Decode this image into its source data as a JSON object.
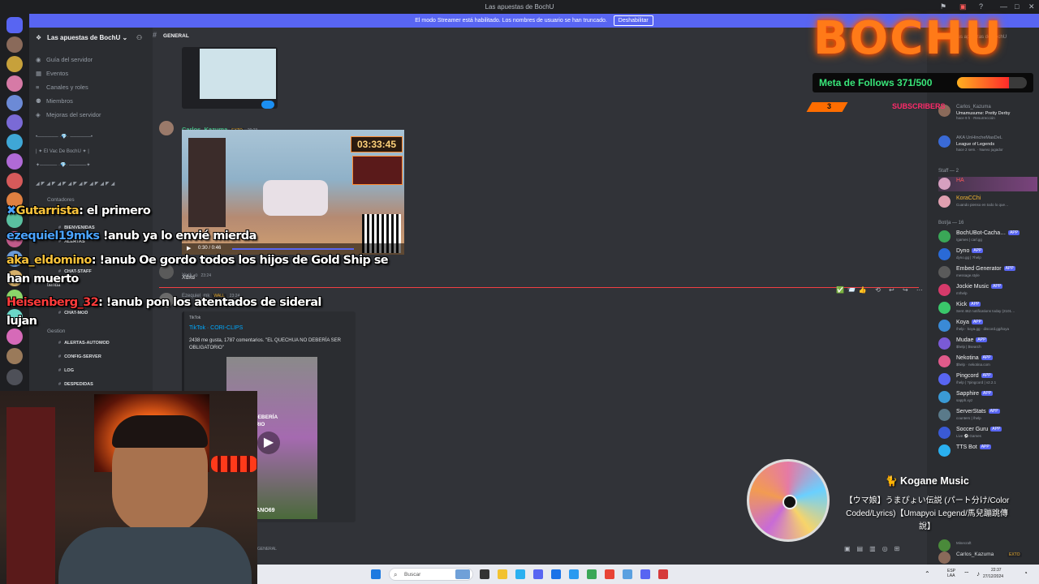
{
  "window": {
    "title": "Las apuestas de BochU",
    "controls": [
      "—",
      "□",
      "✕"
    ]
  },
  "banner": {
    "text": "El modo Streamer está habilitado. Los nombres de usuario se han truncado.",
    "button": "Deshabilitar"
  },
  "sidebar": {
    "server_name": "Las apuestas de BochU",
    "nav": [
      {
        "label": "Guía del servidor",
        "icon": "compass-icon"
      },
      {
        "label": "Eventos",
        "icon": "calendar-icon"
      },
      {
        "label": "Canales y roles",
        "icon": "list-icon"
      },
      {
        "label": "Miembros",
        "icon": "members-icon"
      },
      {
        "label": "Mejoras del servidor",
        "icon": "boost-icon"
      }
    ],
    "decor": [
      "•────── ·💎· ──────•",
      "| ✦ El Vac De BochU ✦ |",
      "✦───── ·💎· ─────✦"
    ],
    "categories": [
      {
        "label": "Contadores"
      },
      {
        "label": "Gestion"
      }
    ],
    "channels": [
      "BIENVENIDAS",
      "ALERTAS",
      "CHAT-STAFF",
      "CHAT-MOD",
      "ALERTAS-AUTOMOD",
      "CONFIG-SERVER",
      "LOG",
      "DESPEDIDAS"
    ],
    "misc": "tienda"
  },
  "main": {
    "channel": "GENERAL",
    "messages": [
      {
        "author": "Carlos_Kazuma",
        "badge": "EXTO",
        "time": "20:23",
        "video_time": "0:30 / 0:46",
        "timer": "03:33:45"
      },
      {
        "author": "Yeck_o",
        "time": "23:24",
        "text": "Xdxd"
      },
      {
        "author": "Ezequiel_mk",
        "badge": "WALL",
        "time": "23:24",
        "embed_provider": "TikTok",
        "embed_title": "TikTok · CORI-CLIPS",
        "embed_desc": "2438 me gusta, 1787 comentarios. \"EL QUECHUA NO DEBERÍA SER OBLIGATORIO\"",
        "thumb_caption": "CHUA NO DEBERÍA\nOBLIGATORIO",
        "thumb_credit": "GOBLINCIANO69"
      }
    ],
    "footer_channel": "GENERAL"
  },
  "members": {
    "search_placeholder": "Buscar Las apuestas de BochU",
    "top": [
      {
        "name": "Carlos_Kazuma",
        "sub": "hace 9 h · Resurrección",
        "extra": "Umamusume: Pretty Derby"
      },
      {
        "name": "AKA UnHincheMasDeL",
        "sub": "hace 2 sem. · Nuevo jugador",
        "extra": "League of Legends"
      }
    ],
    "groups": [
      {
        "label": "Staff — 2",
        "items": [
          {
            "name": "HA",
            "sub": "",
            "color": "#ff5a5a"
          },
          {
            "name": "KoraCChi",
            "sub": "Cuando pienso en todo lo que…",
            "color": "#f0b232"
          }
        ]
      },
      {
        "label": "Bot/ja — 16",
        "items": [
          {
            "name": "BochUBot-Cacha…",
            "sub": "/games | carl.gg",
            "app": "APP"
          },
          {
            "name": "Dyno",
            "sub": "dyno.gg | ?help",
            "app": "APP"
          },
          {
            "name": "Embed Generator",
            "sub": "message.style",
            "app": "APP"
          },
          {
            "name": "Jockie Music",
            "sub": "m!help",
            "app": "APP"
          },
          {
            "name": "Kick",
            "sub": "Sent 462 notifications today (2101…",
            "app": "APP"
          },
          {
            "name": "Koya",
            "sub": "/help · koya.gg · discord.gg/koya",
            "app": "APP"
          },
          {
            "name": "Mudae",
            "sub": "$help | $search",
            "app": "APP"
          },
          {
            "name": "Nekotina",
            "sub": "$help · nekotina.com",
            "app": "APP"
          },
          {
            "name": "Pingcord",
            "sub": "/help | ?pingcord | v2.2.1",
            "app": "APP"
          },
          {
            "name": "Sapphire",
            "sub": "sapph.xyz",
            "app": "APP"
          },
          {
            "name": "ServerStats",
            "sub": "counters | /help",
            "app": "APP"
          },
          {
            "name": "Soccer Guru",
            "sub": "Live ⚽ Games",
            "app": "APP"
          },
          {
            "name": "TTS Bot",
            "sub": "",
            "app": "APP"
          }
        ]
      }
    ],
    "bottom": [
      {
        "name": "Minecraft",
        "sub": ""
      },
      {
        "name": "Carlos_Kazuma",
        "badge": "EXTO"
      }
    ]
  },
  "overlay": {
    "logo": "BOCHU",
    "follows_label": "Meta de Follows 371/500",
    "follows_progress": 0.742,
    "subs_label": "SUBSCRIBERS",
    "subs_value": "3",
    "chat": [
      {
        "user": "Gutarrista",
        "text": "el primero",
        "user_color": "#f7c23b",
        "icon": "✖"
      },
      {
        "user": "ezequiel19mks",
        "text": "!anub ya lo envié mierda",
        "user_color": "#4aa3ff",
        "icon": ""
      },
      {
        "user": "aka_eldomino",
        "text": "!anub Oe gordo todos los hijos de Gold Ship se",
        "text2": "han muerto",
        "user_color": "#f7c23b",
        "icon": ""
      },
      {
        "user": "Heisenberg_32",
        "text": "!anub pon los atentados de sideral",
        "text2": "lujan",
        "user_color": "#ff3b3b",
        "icon": ""
      }
    ],
    "music": {
      "title": "Kogane Music",
      "song": "【ウマ娘】うまぴょい伝説 (パート分け/Color Coded/Lyrics)【Umapyoi Legend/馬兒蹦跳傳說】"
    }
  },
  "taskbar": {
    "search": "Buscar",
    "lang": "ESP\nLAA",
    "time": "22:37",
    "date": "27/12/2024"
  },
  "colors": {
    "blurple": "#5865f2",
    "overlay_orange": "#ff7a18",
    "follows_green": "#39e67a"
  }
}
